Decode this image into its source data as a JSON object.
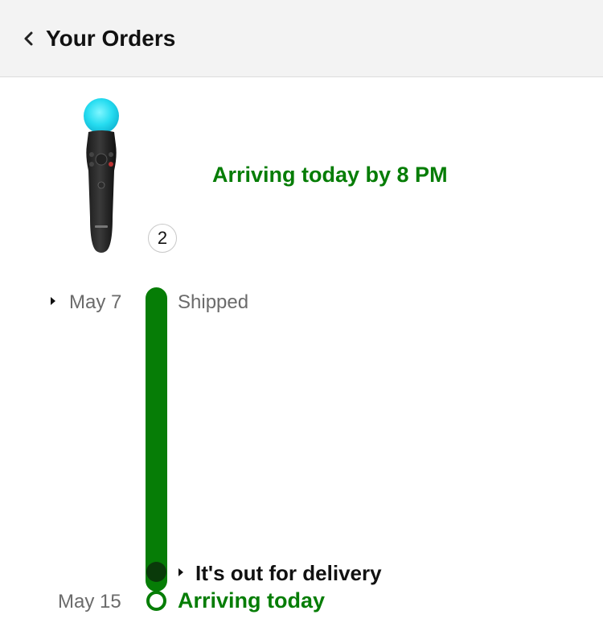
{
  "header": {
    "title": "Your Orders",
    "back_icon": "chevron-left-icon"
  },
  "order": {
    "product_image": "playstation-move-controller",
    "quantity": "2",
    "headline": "Arriving today by 8 PM"
  },
  "timeline": {
    "events": [
      {
        "date": "May 7",
        "label": "Shipped",
        "expandable": true
      },
      {
        "date": "",
        "label": "It's out for delivery",
        "expandable": true,
        "status": "current"
      },
      {
        "date": "May 15",
        "label": "Arriving today",
        "expandable": false,
        "status": "upcoming"
      }
    ]
  },
  "colors": {
    "accent_green": "#067d06",
    "current_dot": "#0a3a0a",
    "header_bg": "#f3f3f3",
    "muted_text": "#6b6b6b"
  }
}
